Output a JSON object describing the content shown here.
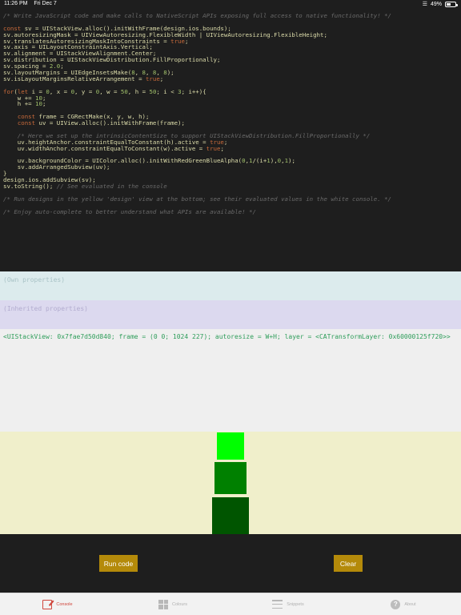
{
  "status_bar": {
    "time": "11:26 PM",
    "date": "Fri Dec 7",
    "battery": "49%",
    "icons": [
      "wifi-icon",
      "battery-icon"
    ]
  },
  "editor": {
    "lines": [
      [
        {
          "t": "/* Write JavaScript code and make calls to NativeScript APIs exposing full access to native functionality! */",
          "c": "com"
        }
      ],
      [
        {
          "t": "",
          "c": "txt"
        }
      ],
      [
        {
          "t": "const",
          "c": "kw"
        },
        {
          "t": " sv = UIStackView.alloc().initWithFrame(design.ios.bounds);",
          "c": "txt"
        }
      ],
      [
        {
          "t": "sv.autoresizingMask = UIViewAutoresizing.FlexibleWidth | UIViewAutoresizing.FlexibleHeight;",
          "c": "txt"
        }
      ],
      [
        {
          "t": "sv.translatesAutoresizingMaskIntoConstraints = ",
          "c": "txt"
        },
        {
          "t": "true",
          "c": "kw"
        },
        {
          "t": ";",
          "c": "txt"
        }
      ],
      [
        {
          "t": "sv.axis = UILayoutConstraintAxis.Vertical;",
          "c": "txt"
        }
      ],
      [
        {
          "t": "sv.alignment = UIStackViewAlignment.Center;",
          "c": "txt"
        }
      ],
      [
        {
          "t": "sv.distribution = UIStackViewDistribution.FillProportionally;",
          "c": "txt"
        }
      ],
      [
        {
          "t": "sv.spacing = ",
          "c": "txt"
        },
        {
          "t": "2.0",
          "c": "num"
        },
        {
          "t": ";",
          "c": "txt"
        }
      ],
      [
        {
          "t": "sv.layoutMargins = UIEdgeInsetsMake(",
          "c": "txt"
        },
        {
          "t": "8",
          "c": "num"
        },
        {
          "t": ", ",
          "c": "txt"
        },
        {
          "t": "8",
          "c": "num"
        },
        {
          "t": ", ",
          "c": "txt"
        },
        {
          "t": "8",
          "c": "num"
        },
        {
          "t": ", ",
          "c": "txt"
        },
        {
          "t": "8",
          "c": "num"
        },
        {
          "t": ");",
          "c": "txt"
        }
      ],
      [
        {
          "t": "sv.isLayoutMarginsRelativeArrangement = ",
          "c": "txt"
        },
        {
          "t": "true",
          "c": "kw"
        },
        {
          "t": ";",
          "c": "txt"
        }
      ],
      [
        {
          "t": "",
          "c": "txt"
        }
      ],
      [
        {
          "t": "for",
          "c": "kw"
        },
        {
          "t": "(",
          "c": "txt"
        },
        {
          "t": "let",
          "c": "kw"
        },
        {
          "t": " i = ",
          "c": "txt"
        },
        {
          "t": "0",
          "c": "num"
        },
        {
          "t": ", x = ",
          "c": "txt"
        },
        {
          "t": "0",
          "c": "num"
        },
        {
          "t": ", y = ",
          "c": "txt"
        },
        {
          "t": "0",
          "c": "num"
        },
        {
          "t": ", w = ",
          "c": "txt"
        },
        {
          "t": "50",
          "c": "num"
        },
        {
          "t": ", h = ",
          "c": "txt"
        },
        {
          "t": "50",
          "c": "num"
        },
        {
          "t": "; i < ",
          "c": "txt"
        },
        {
          "t": "3",
          "c": "num"
        },
        {
          "t": "; i++){",
          "c": "txt"
        }
      ],
      [
        {
          "t": "    w += ",
          "c": "txt"
        },
        {
          "t": "10",
          "c": "num"
        },
        {
          "t": ";",
          "c": "txt"
        }
      ],
      [
        {
          "t": "    h += ",
          "c": "txt"
        },
        {
          "t": "10",
          "c": "num"
        },
        {
          "t": ";",
          "c": "txt"
        }
      ],
      [
        {
          "t": "",
          "c": "txt"
        }
      ],
      [
        {
          "t": "    ",
          "c": "txt"
        },
        {
          "t": "const",
          "c": "kw"
        },
        {
          "t": " frame = CGRectMake(x, y, w, h);",
          "c": "txt"
        }
      ],
      [
        {
          "t": "    ",
          "c": "txt"
        },
        {
          "t": "const",
          "c": "kw"
        },
        {
          "t": " uv = UIView.alloc().initWithFrame(frame);",
          "c": "txt"
        }
      ],
      [
        {
          "t": "",
          "c": "txt"
        }
      ],
      [
        {
          "t": "    /* Here we set up the intrinsicContentSize to support UIStackViewDistribution.FillProportionally */",
          "c": "com"
        }
      ],
      [
        {
          "t": "    uv.heightAnchor.constraintEqualToConstant(h).active = ",
          "c": "txt"
        },
        {
          "t": "true",
          "c": "kw"
        },
        {
          "t": ";",
          "c": "txt"
        }
      ],
      [
        {
          "t": "    uv.widthAnchor.constraintEqualToConstant(w).active = ",
          "c": "txt"
        },
        {
          "t": "true",
          "c": "kw"
        },
        {
          "t": ";",
          "c": "txt"
        }
      ],
      [
        {
          "t": "",
          "c": "txt"
        }
      ],
      [
        {
          "t": "    uv.backgroundColor = UIColor.alloc().initWithRedGreenBlueAlpha(",
          "c": "txt"
        },
        {
          "t": "0",
          "c": "num"
        },
        {
          "t": ",",
          "c": "txt"
        },
        {
          "t": "1",
          "c": "num"
        },
        {
          "t": "/(i+",
          "c": "txt"
        },
        {
          "t": "1",
          "c": "num"
        },
        {
          "t": "),",
          "c": "txt"
        },
        {
          "t": "0",
          "c": "num"
        },
        {
          "t": ",",
          "c": "txt"
        },
        {
          "t": "1",
          "c": "num"
        },
        {
          "t": ");",
          "c": "txt"
        }
      ],
      [
        {
          "t": "    sv.addArrangedSubview(uv);",
          "c": "txt"
        }
      ],
      [
        {
          "t": "}",
          "c": "txt"
        }
      ],
      [
        {
          "t": "design.ios.addSubview(sv);",
          "c": "txt"
        }
      ],
      [
        {
          "t": "sv.toString(); ",
          "c": "txt"
        },
        {
          "t": "// See evaluated in the console",
          "c": "com"
        }
      ],
      [
        {
          "t": "",
          "c": "txt"
        }
      ],
      [
        {
          "t": "/* Run designs in the yellow 'design' view at the bottom; see their evaluated values in the white console. */",
          "c": "com"
        }
      ],
      [
        {
          "t": "",
          "c": "txt"
        }
      ],
      [
        {
          "t": "/* Enjoy auto-complete to better understand what APIs are available! */",
          "c": "com"
        }
      ]
    ]
  },
  "properties_panel": {
    "placeholder": "(Own properties)"
  },
  "inherited_panel": {
    "placeholder": "(Inherited properties)"
  },
  "console": {
    "output": "<UIStackView: 0x7fae7d50d840; frame = (0 0; 1024 227); autoresize = W+H; layer = <CATransformLayer: 0x60000125f720>>"
  },
  "design_view": {
    "background": "#f0efcb",
    "squares": [
      {
        "color": "#00ff00"
      },
      {
        "color": "#008000"
      },
      {
        "color": "#005500"
      }
    ]
  },
  "buttons": {
    "run_label": "Run code",
    "clear_label": "Clear"
  },
  "tabs": [
    {
      "label": "Console",
      "icon": "console-icon",
      "active": true
    },
    {
      "label": "Colours",
      "icon": "colours-icon",
      "active": false
    },
    {
      "label": "Snippets",
      "icon": "snippets-icon",
      "active": false
    },
    {
      "label": "About",
      "icon": "about-icon",
      "active": false
    }
  ]
}
